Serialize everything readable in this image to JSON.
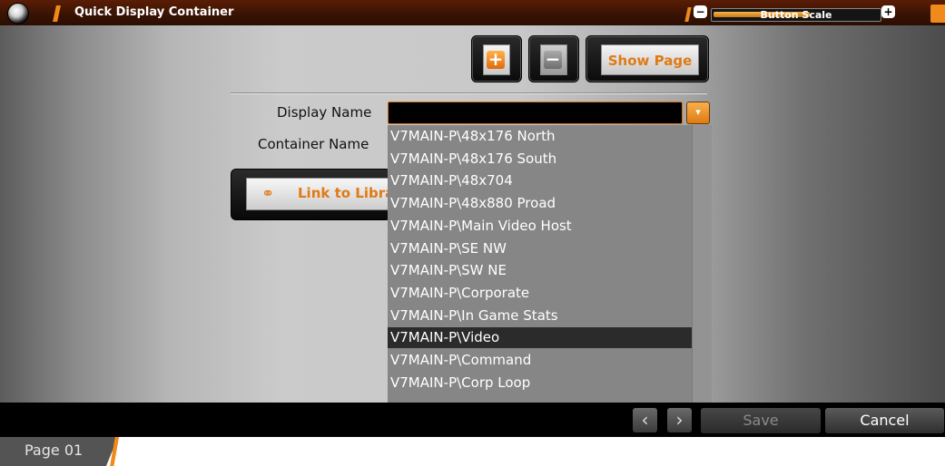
{
  "window": {
    "title": "Quick Display Container",
    "scale_label": "Button Scale",
    "scale_minus": "−",
    "scale_plus": "+",
    "scale_level": 0.58
  },
  "toolbar": {
    "add_glyph": "+",
    "remove_glyph": "−",
    "show_page_label": "Show Page"
  },
  "form": {
    "display_name_label": "Display Name",
    "display_name_value": "",
    "container_name_label": "Container Name",
    "link_button_label": "Link to Libra",
    "dropdown_glyph": "▾"
  },
  "dropdown": {
    "items": [
      "V7MAIN-P\\48x176 North",
      "V7MAIN-P\\48x176 South",
      "V7MAIN-P\\48x704",
      "V7MAIN-P\\48x880 Proad",
      "V7MAIN-P\\Main Video Host",
      "V7MAIN-P\\SE NW",
      "V7MAIN-P\\SW NE",
      "V7MAIN-P\\Corporate",
      "V7MAIN-P\\In Game Stats",
      "V7MAIN-P\\Video",
      "V7MAIN-P\\Command",
      "V7MAIN-P\\Corp Loop"
    ],
    "selected_index": 9
  },
  "footer": {
    "prev_glyph": "‹",
    "next_glyph": "›",
    "save_label": "Save",
    "cancel_label": "Cancel",
    "page_label": "Page 01"
  },
  "colors": {
    "accent": "#f08a1a",
    "title_bar": "#3a1303"
  }
}
